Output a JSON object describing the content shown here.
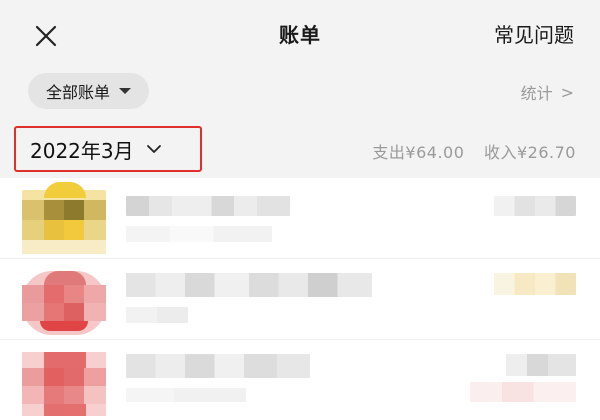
{
  "header": {
    "close_icon": "close-icon",
    "title": "账单",
    "faq_label": "常见问题"
  },
  "filter": {
    "selected": "全部账单",
    "stats_label": "统计",
    "stats_chevron": ">"
  },
  "month_bar": {
    "month_label": "2022年3月",
    "expense": "支出¥64.00",
    "income": "收入¥26.70"
  },
  "colors": {
    "accent_highlight": "#e0302b",
    "background_gray": "#f3f3f3",
    "muted_text": "#9a9a9a"
  },
  "transactions": [
    {
      "avatar_color": "#e9c94a",
      "icon": "avatar-icon"
    },
    {
      "avatar_color": "#e47878",
      "icon": "avatar-icon"
    },
    {
      "avatar_color": "#e56e6e",
      "icon": "avatar-icon"
    }
  ]
}
